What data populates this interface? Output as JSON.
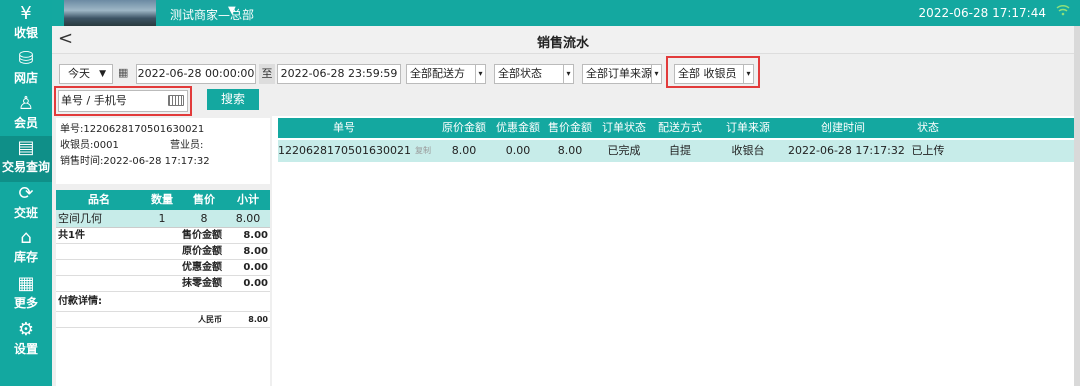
{
  "topbar": {
    "store_name": "测试商家—总部",
    "store_caret": "▼",
    "datetime": "2022-06-28 17:17:44"
  },
  "sidebar": {
    "items": [
      {
        "label": "收银",
        "icon": "cashier-icon",
        "glyph": "¥"
      },
      {
        "label": "网店",
        "icon": "shop-icon",
        "glyph": "⛁"
      },
      {
        "label": "会员",
        "icon": "member-icon",
        "glyph": "♙"
      },
      {
        "label": "交易查询",
        "icon": "transaction-icon",
        "glyph": "▤"
      },
      {
        "label": "交班",
        "icon": "handover-icon",
        "glyph": "⟳"
      },
      {
        "label": "库存",
        "icon": "inventory-icon",
        "glyph": "⌂"
      },
      {
        "label": "更多",
        "icon": "more-icon",
        "glyph": "▦"
      },
      {
        "label": "设置",
        "icon": "settings-icon",
        "glyph": "⚙"
      }
    ]
  },
  "page": {
    "back": "<",
    "title": "销售流水"
  },
  "filters": {
    "day": "今天",
    "date_from": "2022-06-28 00:00:00",
    "to_label": "至",
    "date_to": "2022-06-28 23:59:59",
    "delivery": "全部配送方",
    "status": "全部状态",
    "source": "全部订单来源",
    "cashier": "全部 收银员",
    "order_no_placeholder": "单号  / 手机号",
    "search_label": "搜索"
  },
  "receipt": {
    "order_no": "单号:12206281705016300​21",
    "cashier": "收银员:0001",
    "salesperson": "营业员:",
    "sale_time": "销售时间:2022-06-28 17:17:32"
  },
  "items_table": {
    "headers": [
      "品名",
      "数量",
      "售价",
      "小计"
    ],
    "rows": [
      {
        "name": "空间几何",
        "qty": "1",
        "price": "8",
        "subtotal": "8.00"
      }
    ],
    "count_label": "共1件",
    "summary": [
      {
        "label": "售价金额",
        "value": "8.00"
      },
      {
        "label": "原价金额",
        "value": "8.00"
      },
      {
        "label": "优惠金额",
        "value": "0.00"
      },
      {
        "label": "抹零金额",
        "value": "0.00"
      }
    ],
    "payment_label": "付款详情:",
    "payment_method": "人民币",
    "payment_value": "8.00"
  },
  "orders_table": {
    "headers": [
      "单号",
      "原价金额",
      "优惠金额",
      "售价金额",
      "订单状态",
      "配送方式",
      "订单来源",
      "创建时间",
      "状态"
    ],
    "rows": [
      {
        "order_no": "1220628170501630021",
        "copy": "复制",
        "orig": "8.00",
        "disc": "0.00",
        "sale": "8.00",
        "order_status": "已完成",
        "shipping": "自提",
        "source": "收银台",
        "created": "2022-06-28 17:17:32",
        "status": "已上传"
      }
    ]
  },
  "colors": {
    "brand": "#14a8a0",
    "highlight_row": "#c7ece9",
    "annotation_red": "#e23b3b"
  }
}
